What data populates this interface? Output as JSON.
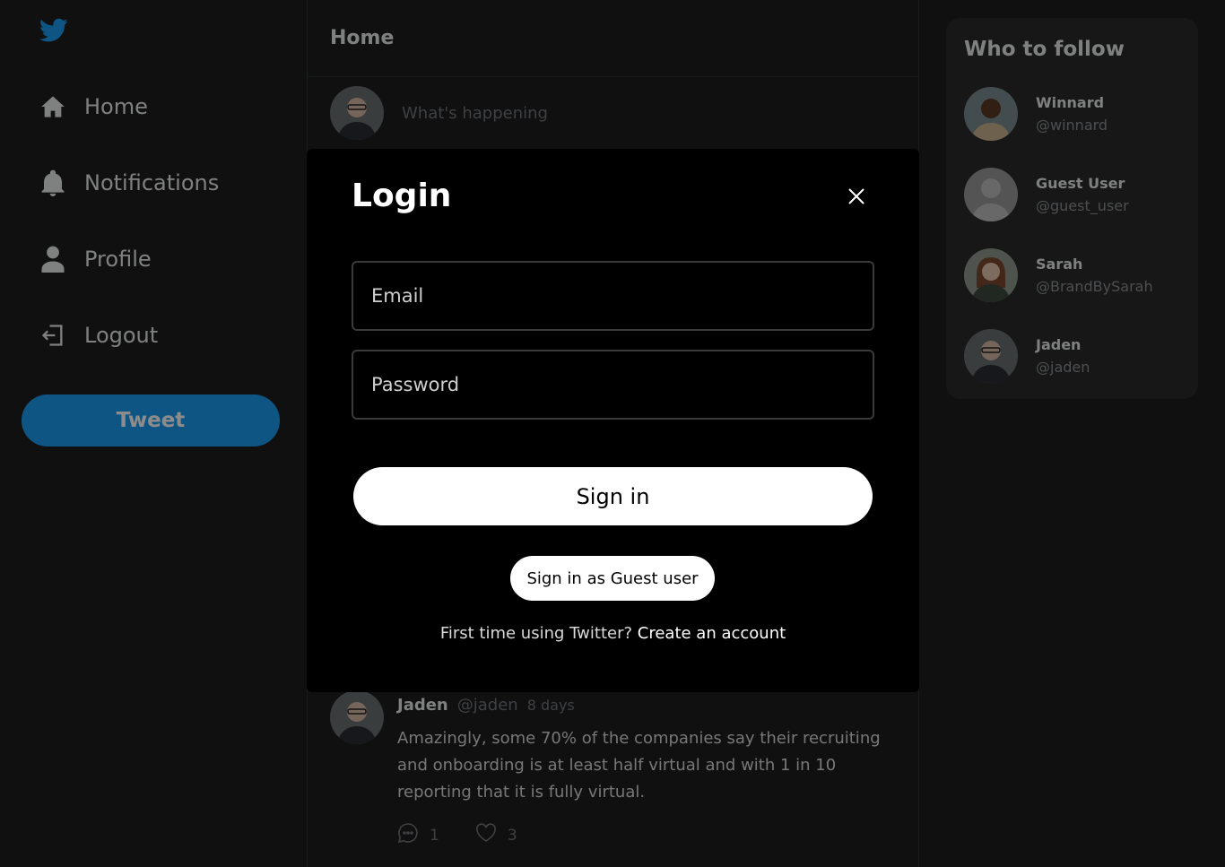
{
  "sidebar": {
    "logo_icon": "twitter-bird-icon",
    "items": [
      {
        "label": "Home",
        "icon": "home-icon"
      },
      {
        "label": "Notifications",
        "icon": "bell-icon"
      },
      {
        "label": "Profile",
        "icon": "user-icon"
      },
      {
        "label": "Logout",
        "icon": "logout-icon"
      }
    ],
    "tweet_button": "Tweet"
  },
  "main": {
    "title": "Home",
    "compose_placeholder": "What's happening",
    "tweet": {
      "name": "Jaden",
      "handle": "@jaden",
      "time": "8 days",
      "text": "Amazingly, some 70% of the companies say their recruiting and onboarding is at least half virtual and with 1 in 10 reporting that it is fully virtual.",
      "comments": "1",
      "likes": "3"
    }
  },
  "who_to_follow": {
    "title": "Who to follow",
    "users": [
      {
        "name": "Winnard",
        "handle": "@winnard"
      },
      {
        "name": "Guest User",
        "handle": "@guest_user"
      },
      {
        "name": "Sarah",
        "handle": "@BrandBySarah"
      },
      {
        "name": "Jaden",
        "handle": "@jaden"
      }
    ]
  },
  "login_modal": {
    "title": "Login",
    "email_placeholder": "Email",
    "password_placeholder": "Password",
    "signin_label": "Sign in",
    "guest_label": "Sign in as Guest user",
    "signup_prompt": "First time using Twitter?",
    "signup_link": "Create an account"
  },
  "colors": {
    "accent": "#1d9bf0",
    "background": "#1e1e1e",
    "modal_background": "#000000"
  }
}
